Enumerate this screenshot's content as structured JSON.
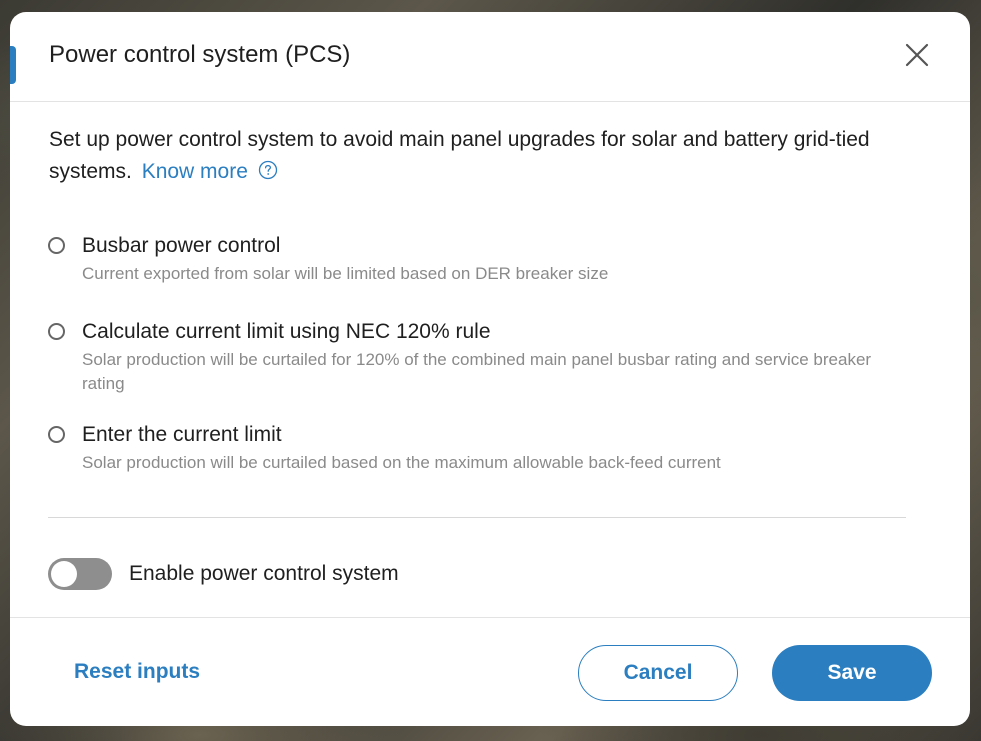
{
  "dialog": {
    "title": "Power control system (PCS)",
    "close_icon": "close-icon",
    "intro_text": "Set up power control system to avoid main panel upgrades for solar and battery grid-tied systems.",
    "know_more_label": "Know more",
    "help_icon": "question-circle-icon"
  },
  "options": [
    {
      "label": "Busbar power control",
      "description": "Current exported from solar will be limited based on DER breaker size",
      "selected": false
    },
    {
      "label": "Calculate current limit using NEC 120% rule",
      "description": "Solar production will be curtailed for 120% of the combined main panel busbar rating and service breaker rating",
      "selected": false
    },
    {
      "label": "Enter the current limit",
      "description": "Solar production will be curtailed based on the maximum allowable back-feed current",
      "selected": false
    }
  ],
  "toggle": {
    "label": "Enable power control system",
    "enabled": false
  },
  "footer": {
    "reset_label": "Reset inputs",
    "cancel_label": "Cancel",
    "save_label": "Save"
  },
  "colors": {
    "accent": "#2b7ec0",
    "toggle_off": "#8e8e8e",
    "description_text": "#8a8a8a"
  }
}
